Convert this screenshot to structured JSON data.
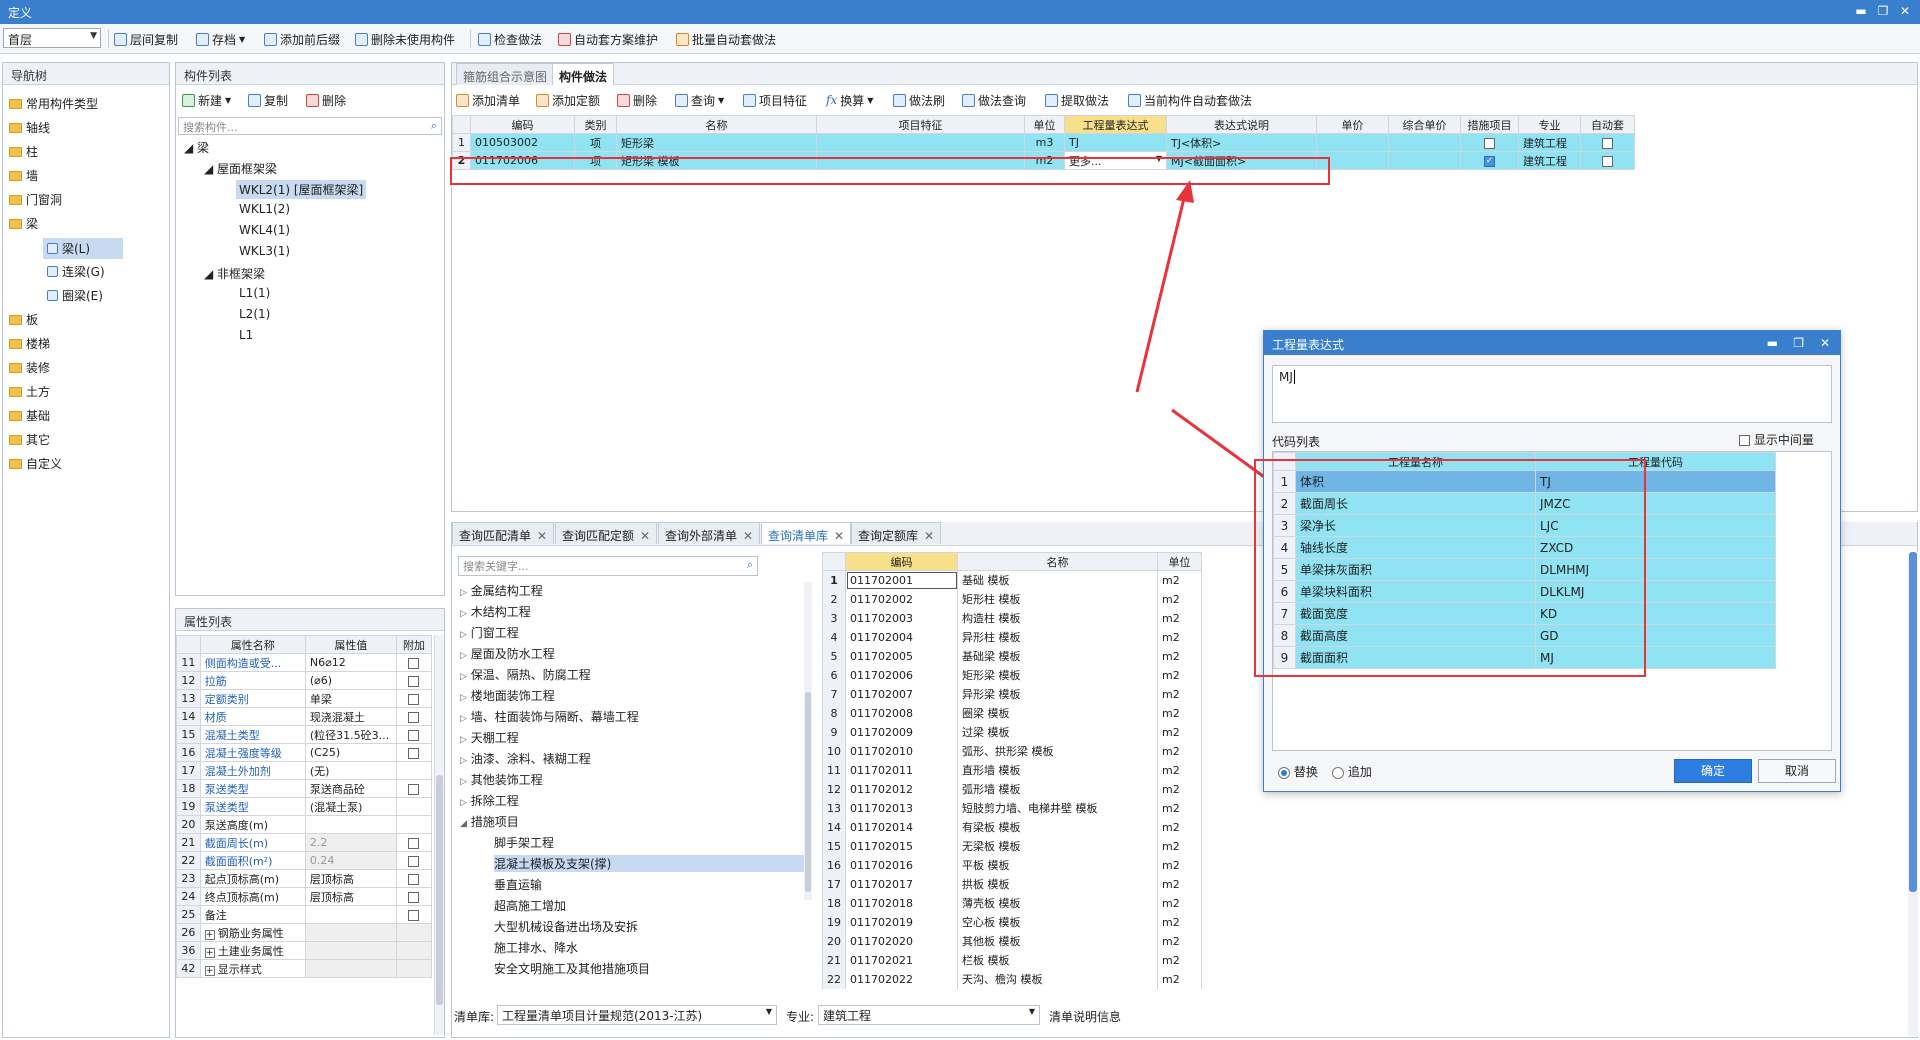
{
  "window": {
    "title": "定义",
    "min": "▬",
    "restore": "❐",
    "close": "✕"
  },
  "toolbar": {
    "floor": "首层",
    "items": [
      "层间复制",
      "存档",
      "添加前后缀",
      "删除未使用构件",
      "检查做法",
      "自动套方案维护",
      "批量自动套做法"
    ]
  },
  "nav": {
    "title": "导航树",
    "items": [
      "常用构件类型",
      "轴线",
      "柱",
      "墙",
      "门窗洞",
      "梁",
      "板",
      "楼梯",
      "装修",
      "土方",
      "基础",
      "其它",
      "自定义"
    ],
    "beam_children": [
      "梁(L)",
      "连梁(G)",
      "圈梁(E)"
    ]
  },
  "components": {
    "title": "构件列表",
    "new": "新建",
    "copy": "复制",
    "delete": "删除",
    "search_placeholder": "搜索构件...",
    "tree": {
      "root": "梁",
      "group1": "屋面框架梁",
      "items1": [
        "WKL2(1) [屋面框架梁]",
        "WKL1(2)",
        "WKL4(1)",
        "WKL3(1)"
      ],
      "group2": "非框架梁",
      "items2": [
        "L1(1)",
        "L2(1)",
        "L1"
      ]
    }
  },
  "props": {
    "title": "属性列表",
    "headers": [
      "属性名称",
      "属性值",
      "附加"
    ],
    "rows": [
      {
        "n": "11",
        "name": "侧面构造或受...",
        "val": "N6⌀12",
        "chk": true
      },
      {
        "n": "12",
        "name": "拉筋",
        "val": "(⌀6)",
        "chk": true
      },
      {
        "n": "13",
        "name": "定额类别",
        "val": "单梁",
        "chk": true
      },
      {
        "n": "14",
        "name": "材质",
        "val": "现浇混凝土",
        "chk": true
      },
      {
        "n": "15",
        "name": "混凝土类型",
        "val": "(粒径31.5砼3...",
        "chk": true
      },
      {
        "n": "16",
        "name": "混凝土强度等级",
        "val": "(C25)",
        "chk": true
      },
      {
        "n": "17",
        "name": "混凝土外加剂",
        "val": "(无)",
        "chk": false
      },
      {
        "n": "18",
        "name": "泵送类型",
        "val": "泵送商品砼",
        "chk": true
      },
      {
        "n": "19",
        "name": "泵送类型",
        "val": "(混凝土泵)",
        "chk": false
      },
      {
        "n": "20",
        "name": "泵送高度(m)",
        "val": "",
        "chk": false
      },
      {
        "n": "21",
        "name": "截面周长(m)",
        "val": "2.2",
        "chk": true
      },
      {
        "n": "22",
        "name": "截面面积(m²)",
        "val": "0.24",
        "chk": true
      },
      {
        "n": "23",
        "name": "起点顶标高(m)",
        "val": "层顶标高",
        "chk": true
      },
      {
        "n": "24",
        "name": "终点顶标高(m)",
        "val": "层顶标高",
        "chk": true
      },
      {
        "n": "25",
        "name": "备注",
        "val": "",
        "chk": true
      },
      {
        "n": "26",
        "name": "钢筋业务属性",
        "val": "",
        "chk": false
      },
      {
        "n": "36",
        "name": "土建业务属性",
        "val": "",
        "chk": false
      },
      {
        "n": "42",
        "name": "显示样式",
        "val": "",
        "chk": false
      }
    ]
  },
  "method": {
    "tabs": [
      "箍筋组合示意图",
      "构件做法"
    ],
    "actions": [
      "添加清单",
      "添加定额",
      "删除",
      "查询",
      "项目特征",
      "换算",
      "做法刷",
      "做法查询",
      "提取做法",
      "当前构件自动套做法"
    ],
    "headers": [
      "编码",
      "类别",
      "名称",
      "项目特征",
      "单位",
      "工程量表达式",
      "表达式说明",
      "单价",
      "综合单价",
      "措施项目",
      "专业",
      "自动套"
    ],
    "rows": [
      {
        "n": "1",
        "code": "010503002",
        "cat": "项",
        "name": "矩形梁",
        "feature": "",
        "unit": "m3",
        "expr": "TJ",
        "desc": "TJ<体积>",
        "measure": false,
        "major": "建筑工程",
        "auto": false
      },
      {
        "n": "2",
        "code": "011702006",
        "cat": "项",
        "name": "矩形梁 模板",
        "feature": "",
        "unit": "m2",
        "expr": "更多...",
        "desc": "MJ<截面面积>",
        "measure": true,
        "major": "建筑工程",
        "auto": false
      }
    ]
  },
  "query": {
    "tabs": [
      "查询匹配清单",
      "查询匹配定额",
      "查询外部清单",
      "查询清单库",
      "查询定额库"
    ],
    "search_placeholder": "搜索关键字...",
    "tree": [
      "金属结构工程",
      "木结构工程",
      "门窗工程",
      "屋面及防水工程",
      "保温、隔热、防腐工程",
      "楼地面装饰工程",
      "墙、柱面装饰与隔断、幕墙工程",
      "天棚工程",
      "油漆、涂料、裱糊工程",
      "其他装饰工程",
      "拆除工程",
      "措施项目"
    ],
    "subtree": [
      "脚手架工程",
      "混凝土模板及支架(撑)",
      "垂直运输",
      "超高施工增加",
      "大型机械设备进出场及安拆",
      "施工排水、降水",
      "安全文明施工及其他措施项目"
    ],
    "table_headers": [
      "编码",
      "名称",
      "单位"
    ],
    "table": [
      [
        "1",
        "011702001",
        "基础 模板",
        "m2"
      ],
      [
        "2",
        "011702002",
        "矩形柱 模板",
        "m2"
      ],
      [
        "3",
        "011702003",
        "构造柱 模板",
        "m2"
      ],
      [
        "4",
        "011702004",
        "异形柱 模板",
        "m2"
      ],
      [
        "5",
        "011702005",
        "基础梁 模板",
        "m2"
      ],
      [
        "6",
        "011702006",
        "矩形梁 模板",
        "m2"
      ],
      [
        "7",
        "011702007",
        "异形梁 模板",
        "m2"
      ],
      [
        "8",
        "011702008",
        "圈梁 模板",
        "m2"
      ],
      [
        "9",
        "011702009",
        "过梁 模板",
        "m2"
      ],
      [
        "10",
        "011702010",
        "弧形、拱形梁 模板",
        "m2"
      ],
      [
        "11",
        "011702011",
        "直形墙 模板",
        "m2"
      ],
      [
        "12",
        "011702012",
        "弧形墙 模板",
        "m2"
      ],
      [
        "13",
        "011702013",
        "短肢剪力墙、电梯井壁 模板",
        "m2"
      ],
      [
        "14",
        "011702014",
        "有梁板 模板",
        "m2"
      ],
      [
        "15",
        "011702015",
        "无梁板 模板",
        "m2"
      ],
      [
        "16",
        "011702016",
        "平板 模板",
        "m2"
      ],
      [
        "17",
        "011702017",
        "拱板 模板",
        "m2"
      ],
      [
        "18",
        "011702018",
        "薄壳板 模板",
        "m2"
      ],
      [
        "19",
        "011702019",
        "空心板 模板",
        "m2"
      ],
      [
        "20",
        "011702020",
        "其他板 模板",
        "m2"
      ],
      [
        "21",
        "011702021",
        "栏板 模板",
        "m2"
      ],
      [
        "22",
        "011702022",
        "天沟、檐沟 模板",
        "m2"
      ]
    ],
    "footer": {
      "lib_label": "清单库:",
      "lib": "工程量清单项目计量规范(2013-江苏)",
      "major_label": "专业:",
      "major": "建筑工程",
      "info": "清单说明信息"
    }
  },
  "dialog": {
    "title": "工程量表达式",
    "expr": "MJ",
    "code_list": "代码列表",
    "show_mid": "显示中间量",
    "headers": [
      "工程量名称",
      "工程量代码"
    ],
    "rows": [
      [
        "1",
        "体积",
        "TJ"
      ],
      [
        "2",
        "截面周长",
        "JMZC"
      ],
      [
        "3",
        "梁净长",
        "LJC"
      ],
      [
        "4",
        "轴线长度",
        "ZXCD"
      ],
      [
        "5",
        "单梁抹灰面积",
        "DLMHMJ"
      ],
      [
        "6",
        "单梁块料面积",
        "DLKLMJ"
      ],
      [
        "7",
        "截面宽度",
        "KD"
      ],
      [
        "8",
        "截面高度",
        "GD"
      ],
      [
        "9",
        "截面面积",
        "MJ"
      ]
    ],
    "replace": "替换",
    "append": "追加",
    "ok": "确定",
    "cancel": "取消"
  }
}
